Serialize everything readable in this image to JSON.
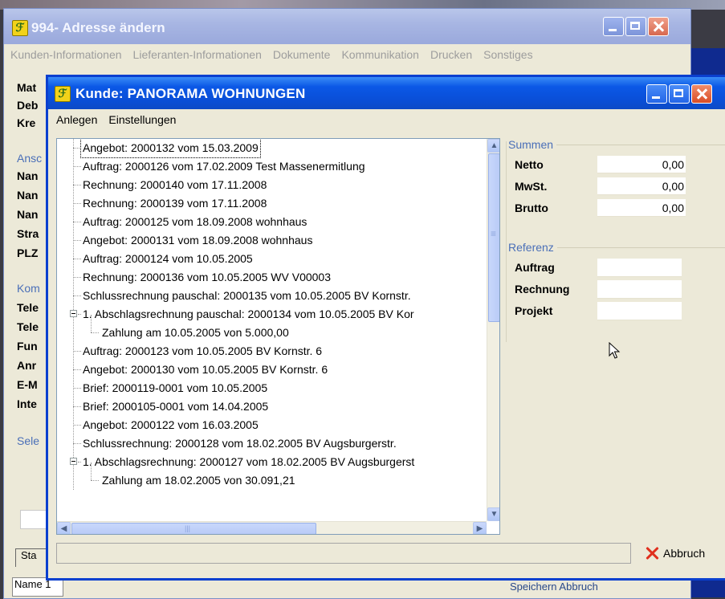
{
  "back_window": {
    "title": "994- Adresse ändern",
    "menu": [
      "Kunden-Informationen",
      "Lieferanten-Informationen",
      "Dokumente",
      "Kommunikation",
      "Drucken",
      "Sonstiges"
    ],
    "labels_top": [
      "Mat",
      "Deb",
      "Kre"
    ],
    "group_ansch": "Ansc",
    "labels_ansch": [
      "Nan",
      "Nan",
      "Nan",
      "Stra",
      "PLZ"
    ],
    "group_komm": "Kom",
    "labels_komm": [
      "Tele",
      "Tele",
      "Fun",
      "Anr",
      "E-M",
      "Inte"
    ],
    "group_sele": "Sele",
    "tab_label": "Sta",
    "status_text": "Name 1",
    "bottom_buttons": "Speichern  Abbruch"
  },
  "front_window": {
    "title": "Kunde: PANORAMA WOHNUNGEN",
    "menu": [
      "Anlegen",
      "Einstellungen"
    ],
    "tree": [
      {
        "text": "Angebot: 2000132 vom 15.03.2009",
        "level": 0,
        "selected": true
      },
      {
        "text": "Auftrag: 2000126 vom 17.02.2009 Test Massenermitlung",
        "level": 0
      },
      {
        "text": "Rechnung: 2000140 vom 17.11.2008",
        "level": 0
      },
      {
        "text": "Rechnung: 2000139 vom 17.11.2008",
        "level": 0
      },
      {
        "text": "Auftrag: 2000125 vom 18.09.2008 wohnhaus",
        "level": 0
      },
      {
        "text": "Angebot: 2000131 vom 18.09.2008 wohnhaus",
        "level": 0
      },
      {
        "text": "Auftrag: 2000124 vom 10.05.2005",
        "level": 0
      },
      {
        "text": "Rechnung: 2000136 vom 10.05.2005 WV V00003",
        "level": 0
      },
      {
        "text": "Schlussrechnung pauschal: 2000135 vom 10.05.2005 BV Kornstr.",
        "level": 0
      },
      {
        "text": "1. Abschlagsrechnung pauschal: 2000134 vom 10.05.2005 BV Kor",
        "level": 0,
        "expander": true
      },
      {
        "text": "Zahlung am 10.05.2005 von 5.000,00",
        "level": 1
      },
      {
        "text": "Auftrag: 2000123 vom 10.05.2005 BV Kornstr. 6",
        "level": 0
      },
      {
        "text": "Angebot: 2000130 vom 10.05.2005 BV Kornstr. 6",
        "level": 0
      },
      {
        "text": "Brief: 2000119-0001 vom 10.05.2005",
        "level": 0
      },
      {
        "text": "Brief: 2000105-0001 vom 14.04.2005",
        "level": 0
      },
      {
        "text": "Angebot: 2000122 vom 16.03.2005",
        "level": 0
      },
      {
        "text": "Schlussrechnung: 2000128 vom 18.02.2005 BV Augsburgerstr.",
        "level": 0
      },
      {
        "text": "1. Abschlagsrechnung: 2000127 vom 18.02.2005 BV Augsburgerst",
        "level": 0,
        "expander": true
      },
      {
        "text": "Zahlung am 18.02.2005 von 30.091,21",
        "level": 1
      }
    ],
    "summen": {
      "legend": "Summen",
      "rows": [
        {
          "label": "Netto",
          "value": "0,00"
        },
        {
          "label": "MwSt.",
          "value": "0,00"
        },
        {
          "label": "Brutto",
          "value": "0,00"
        }
      ]
    },
    "referenz": {
      "legend": "Referenz",
      "rows": [
        {
          "label": "Auftrag",
          "value": ""
        },
        {
          "label": "Rechnung",
          "value": ""
        },
        {
          "label": "Projekt",
          "value": ""
        }
      ]
    },
    "abbruch_label": "Abbruch"
  },
  "icons": {
    "app": "app-logo-icon",
    "minimize": "minimize-icon",
    "maximize": "maximize-icon",
    "close": "close-icon",
    "cancel": "cancel-x-icon",
    "cursor": "mouse-pointer-icon"
  },
  "colors": {
    "title_active": "#0a4fd8",
    "title_inactive": "#a8b6e3",
    "selection": "#3168d5",
    "group_legend": "#4a6fb8",
    "cancel_red": "#e0301e"
  }
}
